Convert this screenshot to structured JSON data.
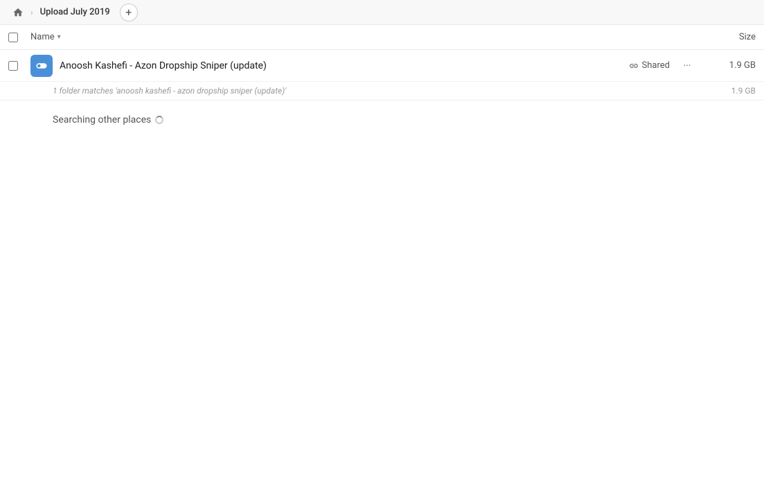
{
  "topbar": {
    "home_label": "Home",
    "breadcrumb_label": "Upload July 2019",
    "add_button_label": "+"
  },
  "columns": {
    "name_label": "Name",
    "size_label": "Size"
  },
  "file_row": {
    "name": "Anoosh Kashefi - Azon Dropship Sniper (update)",
    "shared_label": "Shared",
    "size": "1.9 GB",
    "more_label": "···"
  },
  "match_row": {
    "text": "1 folder matches 'anoosh kashefi - azon dropship sniper (update)'",
    "size": "1.9 GB"
  },
  "searching": {
    "label": "Searching other places"
  }
}
